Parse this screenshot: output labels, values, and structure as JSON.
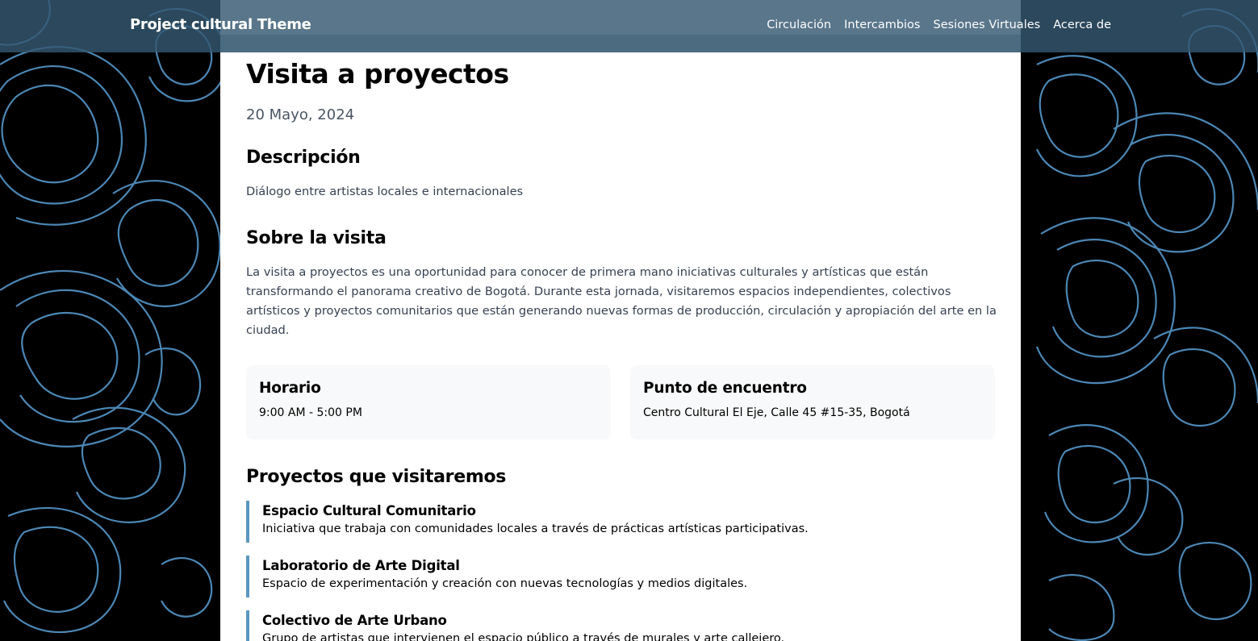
{
  "header": {
    "brand": "Project cultural Theme",
    "nav": [
      "Circulación",
      "Intercambios",
      "Sesiones Virtuales",
      "Acerca de"
    ]
  },
  "page": {
    "title": "Visita a proyectos",
    "date": "20 Mayo, 2024",
    "description_heading": "Descripción",
    "description": "Diálogo entre artistas locales e internacionales",
    "about_heading": "Sobre la visita",
    "about_text": "La visita a proyectos es una oportunidad para conocer de primera mano iniciativas culturales y artísticas que están transformando el panorama creativo de Bogotá. Durante esta jornada, visitaremos espacios independientes, colectivos artísticos y proyectos comunitarios que están generando nuevas formas de producción, circulación y apropiación del arte en la ciudad.",
    "schedule": {
      "label": "Horario",
      "value": "9:00 AM - 5:00 PM"
    },
    "meeting_point": {
      "label": "Punto de encuentro",
      "value": "Centro Cultural El Eje, Calle 45 #15-35, Bogotá"
    },
    "projects_heading": "Proyectos que visitaremos",
    "projects": [
      {
        "name": "Espacio Cultural Comunitario",
        "desc": "Iniciativa que trabaja con comunidades locales a través de prácticas artísticas participativas."
      },
      {
        "name": "Laboratorio de Arte Digital",
        "desc": "Espacio de experimentación y creación con nuevas tecnologías y medios digitales."
      },
      {
        "name": "Colectivo de Arte Urbano",
        "desc": "Grupo de artistas que intervienen el espacio público a través de murales y arte callejero."
      }
    ]
  },
  "colors": {
    "accent": "#5b97c0",
    "header": "#345870",
    "background": "#000000",
    "contour": "#5a9fd4"
  }
}
